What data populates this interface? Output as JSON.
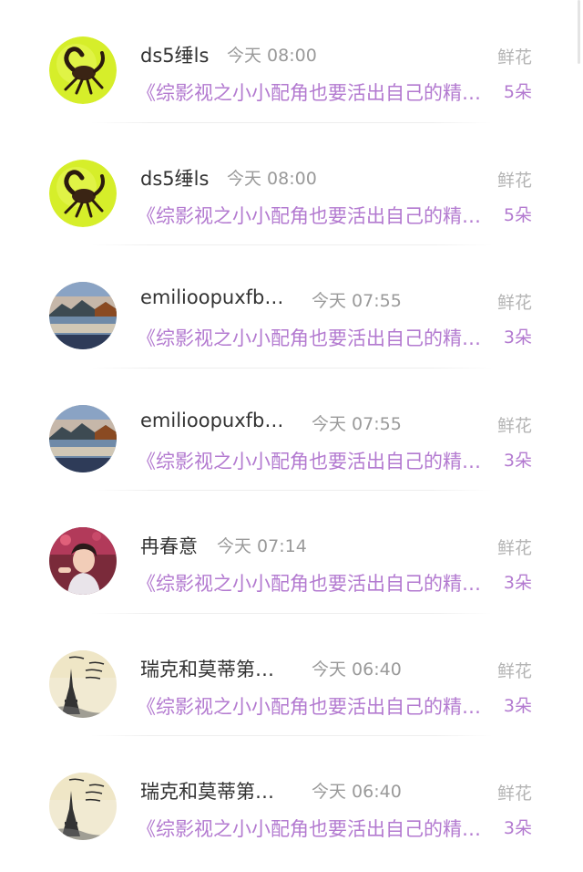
{
  "rows": [
    {
      "name": "ds5缍ls",
      "time": "今天 08:00",
      "title": "《综影视之小小配角也要活出自己的精彩》",
      "flower_label": "鲜花",
      "flower_count": "5朵",
      "avatar": "scorpion"
    },
    {
      "name": "ds5缍ls",
      "time": "今天 08:00",
      "title": "《综影视之小小配角也要活出自己的精彩》",
      "flower_label": "鲜花",
      "flower_count": "5朵",
      "avatar": "scorpion"
    },
    {
      "name": "emilioopuxfbeee",
      "time": "今天 07:55",
      "title": "《综影视之小小配角也要活出自己的精彩》",
      "flower_label": "鲜花",
      "flower_count": "3朵",
      "avatar": "lake"
    },
    {
      "name": "emilioopuxfbeee",
      "time": "今天 07:55",
      "title": "《综影视之小小配角也要活出自己的精彩》",
      "flower_label": "鲜花",
      "flower_count": "3朵",
      "avatar": "lake"
    },
    {
      "name": "冉春意",
      "time": "今天 07:14",
      "title": "《综影视之小小配角也要活出自己的精彩》",
      "flower_label": "鲜花",
      "flower_count": "3朵",
      "avatar": "child"
    },
    {
      "name": "瑞克和莫蒂第一季",
      "time": "今天 06:40",
      "title": "《综影视之小小配角也要活出自己的精彩》",
      "flower_label": "鲜花",
      "flower_count": "3朵",
      "avatar": "eiffel"
    },
    {
      "name": "瑞克和莫蒂第一季",
      "time": "今天 06:40",
      "title": "《综影视之小小配角也要活出自己的精彩》",
      "flower_label": "鲜花",
      "flower_count": "3朵",
      "avatar": "eiffel"
    }
  ]
}
